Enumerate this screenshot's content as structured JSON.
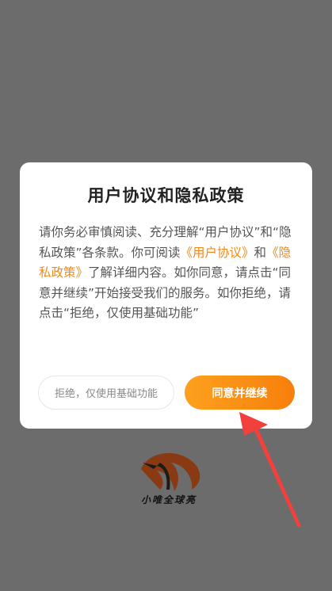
{
  "dialog": {
    "title": "用户协议和隐私政策",
    "body": {
      "p1": "请你务必审慎阅读、充分理解“用户协议”和“隐私政策”各条款。你可阅读",
      "link_user": "《用户协议》",
      "p2": "和",
      "link_privacy": "《隐私政策》",
      "p3": "了解详细内容。如你同意，请点击“同意并继续”开始接受我们的服务。如你拒绝，请点击“拒绝，仅使用基础功能”"
    },
    "decline_label": "拒绝，仅使用基础功能",
    "agree_label": "同意并继续"
  },
  "watermark": {
    "text": "小唯全球亮"
  },
  "colors": {
    "overlay": "#6c6c6c",
    "accent": "#f7870f",
    "arrow": "#f2403d"
  }
}
